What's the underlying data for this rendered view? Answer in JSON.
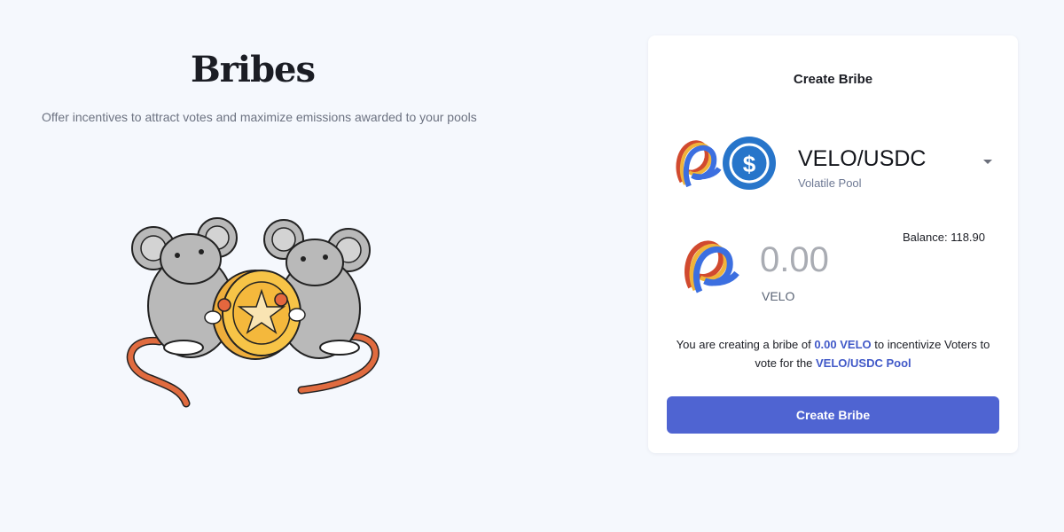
{
  "hero": {
    "title": "Bribes",
    "subtitle": "Offer incentives to attract votes and maximize emissions awarded to your pools"
  },
  "card": {
    "title": "Create Bribe",
    "pool": {
      "name": "VELO/USDC",
      "type": "Volatile Pool"
    },
    "amount": {
      "value": "0.00",
      "token": "VELO",
      "balance_text": "Balance: 118.90"
    },
    "summary": {
      "part1": "You are creating a bribe of ",
      "amount": "0.00 VELO",
      "part2": " to incentivize Voters to vote for the ",
      "pool": "VELO/USDC Pool"
    },
    "button_label": "Create Bribe"
  },
  "colors": {
    "accent": "#4f64d2",
    "highlight": "#4159c8",
    "usdc": "#2775ca",
    "background": "#f5f8fd"
  },
  "icons": [
    "rats-with-coin-illustration",
    "velo-token-icon",
    "usdc-token-icon",
    "chevron-down-icon"
  ]
}
